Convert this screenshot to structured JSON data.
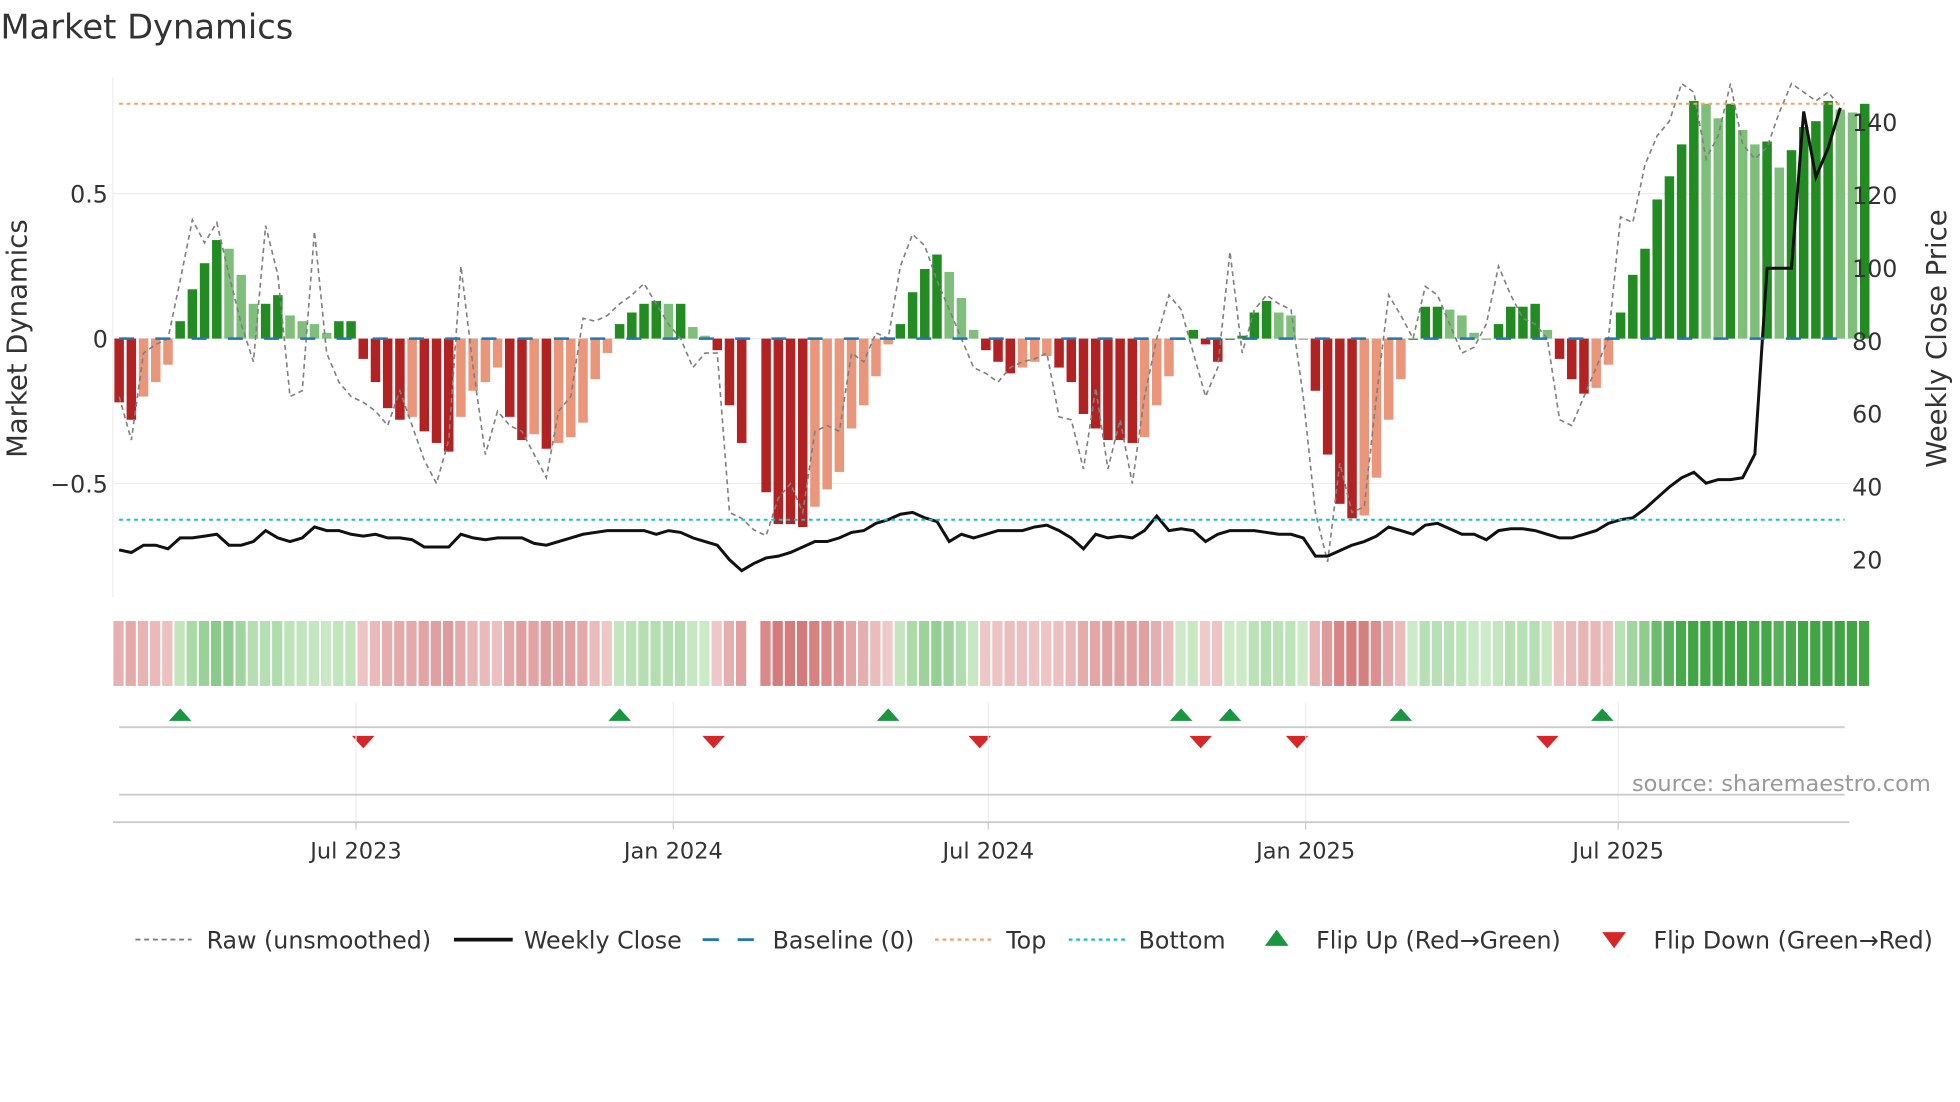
{
  "title": "Market Dynamics",
  "source": "source: sharemaestro.com",
  "chart_data": {
    "type": "bar",
    "title": "Market Dynamics",
    "ylabel": "Market Dynamics",
    "y2label": "Weekly Close Price",
    "ylim": [
      -0.9,
      0.92
    ],
    "y2lim": [
      11,
      151
    ],
    "yticks": [
      {
        "v": 0.5,
        "label": "0.5"
      },
      {
        "v": 0,
        "label": "0"
      },
      {
        "v": -0.5,
        "label": "−0.5"
      }
    ],
    "y2ticks": [
      {
        "v": 140,
        "label": "140"
      },
      {
        "v": 120,
        "label": "120"
      },
      {
        "v": 100,
        "label": "100"
      },
      {
        "v": 80,
        "label": "80"
      },
      {
        "v": 60,
        "label": "60"
      },
      {
        "v": 40,
        "label": "40"
      },
      {
        "v": 20,
        "label": "20"
      }
    ],
    "xticks": [
      {
        "week": 19.4,
        "label": "Jul 2023"
      },
      {
        "week": 45.4,
        "label": "Jan 2024"
      },
      {
        "week": 71.2,
        "label": "Jul 2024"
      },
      {
        "week": 97.2,
        "label": "Jan 2025"
      },
      {
        "week": 122.8,
        "label": "Jul 2025"
      }
    ],
    "top": 0.81,
    "bottom": -0.625,
    "baseline": 0,
    "smoothed": [
      -0.22,
      -0.28,
      -0.2,
      -0.15,
      -0.09,
      0.06,
      0.17,
      0.26,
      0.34,
      0.31,
      0.22,
      0.12,
      0.12,
      0.15,
      0.08,
      0.06,
      0.05,
      0.02,
      0.06,
      0.06,
      -0.07,
      -0.15,
      -0.24,
      -0.28,
      -0.27,
      -0.32,
      -0.36,
      -0.39,
      -0.27,
      -0.18,
      -0.15,
      -0.1,
      -0.27,
      -0.35,
      -0.33,
      -0.38,
      -0.36,
      -0.34,
      -0.29,
      -0.14,
      -0.05,
      0.05,
      0.09,
      0.12,
      0.13,
      0.12,
      0.12,
      0.04,
      0.01,
      -0.04,
      -0.23,
      -0.36,
      null,
      -0.53,
      -0.64,
      -0.64,
      -0.65,
      -0.58,
      -0.52,
      -0.46,
      -0.31,
      -0.23,
      -0.13,
      -0.02,
      0.05,
      0.16,
      0.24,
      0.29,
      0.23,
      0.14,
      0.03,
      -0.04,
      -0.08,
      -0.12,
      -0.1,
      -0.08,
      -0.06,
      -0.1,
      -0.15,
      -0.26,
      -0.31,
      -0.35,
      -0.35,
      -0.36,
      -0.34,
      -0.23,
      -0.13,
      0.0,
      0.03,
      -0.02,
      -0.08,
      0.0,
      0.01,
      0.09,
      0.13,
      0.09,
      0.08,
      0.0,
      -0.18,
      -0.4,
      -0.57,
      -0.62,
      -0.61,
      -0.48,
      -0.28,
      -0.14,
      0.0,
      0.11,
      0.11,
      0.1,
      0.08,
      0.02,
      0.0,
      0.05,
      0.11,
      0.11,
      0.12,
      0.03,
      -0.07,
      -0.14,
      -0.19,
      -0.17,
      -0.09,
      0.09,
      0.22,
      0.31,
      0.48,
      0.56,
      0.67,
      0.82,
      0.81,
      0.76,
      0.81,
      0.72,
      0.67,
      0.68,
      0.59,
      0.65,
      0.73,
      0.75,
      0.82,
      0.79,
      0.78,
      0.81
    ],
    "raw": [
      -0.2,
      -0.35,
      -0.05,
      -0.02,
      0.0,
      0.2,
      0.41,
      0.33,
      0.4,
      0.22,
      0.05,
      -0.08,
      0.39,
      0.22,
      -0.2,
      -0.18,
      0.37,
      -0.05,
      -0.15,
      -0.2,
      -0.22,
      -0.25,
      -0.3,
      -0.18,
      -0.3,
      -0.42,
      -0.5,
      -0.35,
      0.25,
      -0.1,
      -0.4,
      -0.25,
      -0.3,
      -0.32,
      -0.4,
      -0.48,
      -0.25,
      -0.2,
      0.07,
      0.06,
      0.08,
      0.12,
      0.15,
      0.19,
      0.12,
      0.05,
      0.0,
      -0.1,
      -0.05,
      -0.05,
      -0.6,
      -0.62,
      -0.66,
      -0.68,
      -0.55,
      -0.5,
      -0.6,
      -0.32,
      -0.3,
      -0.32,
      -0.05,
      -0.08,
      0.02,
      0.0,
      0.25,
      0.36,
      0.32,
      0.2,
      0.1,
      0.0,
      -0.1,
      -0.12,
      -0.15,
      -0.1,
      -0.08,
      -0.07,
      -0.05,
      -0.27,
      -0.28,
      -0.45,
      -0.17,
      -0.45,
      -0.28,
      -0.5,
      -0.2,
      0.0,
      0.15,
      0.1,
      -0.05,
      -0.2,
      -0.1,
      0.3,
      -0.05,
      0.1,
      0.15,
      0.12,
      0.1,
      -0.2,
      -0.6,
      -0.77,
      -0.43,
      -0.6,
      -0.58,
      -0.2,
      0.15,
      0.08,
      0.0,
      0.18,
      0.15,
      0.05,
      -0.05,
      -0.03,
      0.05,
      0.25,
      0.15,
      0.07,
      0.05,
      0.0,
      -0.28,
      -0.3,
      -0.2,
      -0.1,
      0.0,
      0.42,
      0.4,
      0.6,
      0.7,
      0.75,
      0.88,
      0.85,
      0.62,
      0.7,
      0.88,
      0.67,
      0.62,
      0.66,
      0.78,
      0.88,
      0.85,
      0.82,
      0.85,
      0.8
    ],
    "close": [
      22.7,
      22,
      24,
      24,
      23,
      26,
      26,
      26.5,
      27,
      24,
      24,
      25,
      28,
      26,
      25,
      26,
      29,
      28,
      28,
      27,
      26.5,
      27,
      26,
      26,
      25.5,
      23.5,
      23.5,
      23.5,
      27,
      26,
      25.5,
      26,
      26,
      26,
      24.5,
      24,
      25,
      26,
      27,
      27.5,
      28,
      28,
      28,
      28,
      27,
      28,
      27.5,
      26,
      25,
      24,
      20,
      17,
      19,
      20.5,
      21,
      22,
      23.5,
      25,
      25,
      26,
      27.5,
      28,
      30,
      31,
      32.5,
      33,
      31.5,
      30.5,
      25,
      27,
      26,
      27,
      28,
      28,
      28,
      29,
      29.5,
      28,
      26,
      23,
      27,
      26,
      26.5,
      26,
      28,
      32,
      28,
      28.5,
      28,
      25,
      27,
      28,
      28,
      28,
      27.5,
      27,
      27,
      26,
      21,
      21,
      22.5,
      24,
      25,
      26.5,
      29,
      28,
      27,
      29.5,
      30,
      28.5,
      27,
      27,
      25.5,
      28,
      28.5,
      28.5,
      28,
      27,
      26,
      26,
      27,
      28,
      30,
      31,
      31.5,
      34,
      37,
      40,
      42.5,
      44,
      41,
      42,
      42,
      42.5,
      49,
      100,
      100,
      100,
      143,
      125,
      133,
      144
    ],
    "flip_up_weeks": [
      5,
      41,
      63,
      87,
      91,
      105,
      121.5
    ],
    "flip_down_weeks": [
      20,
      48.7,
      70.5,
      88.6,
      96.5,
      117
    ],
    "legend": [
      {
        "key": "raw",
        "label": "Raw (unsmoothed)"
      },
      {
        "key": "close",
        "label": "Weekly Close"
      },
      {
        "key": "baseline",
        "label": "Baseline (0)"
      },
      {
        "key": "top",
        "label": "Top"
      },
      {
        "key": "bottom",
        "label": "Bottom"
      },
      {
        "key": "flipup",
        "label": "Flip Up (Red→Green)"
      },
      {
        "key": "flipdown",
        "label": "Flip Down (Green→Red)"
      }
    ],
    "legend_position": "bottom",
    "colors": {
      "green_dark": "#228b22",
      "green_light": "#7fbf7b",
      "red_dark": "#b22222",
      "red_light": "#e9967a",
      "baseline": "#1f77b4",
      "top": "#f4a460",
      "bottom": "#17becf",
      "raw": "#808080",
      "close": "#111111",
      "flip_up": "#1a9641",
      "flip_down": "#d62728"
    }
  }
}
